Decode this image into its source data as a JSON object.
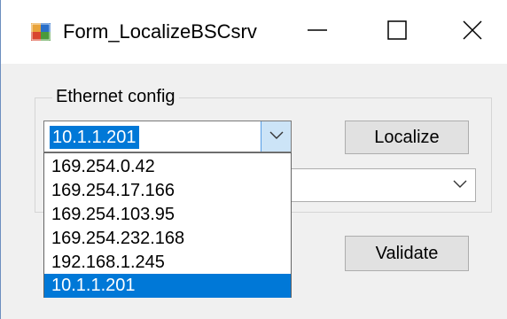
{
  "window": {
    "title": "Form_LocalizeBSCsrv",
    "icon": "form-app-icon",
    "controls": [
      "minimize-icon",
      "maximize-icon",
      "close-icon"
    ]
  },
  "group": {
    "label": "Ethernet config"
  },
  "ip_combo": {
    "value": "10.1.1.201",
    "options": [
      "169.254.0.42",
      "169.254.17.166",
      "169.254.103.95",
      "169.254.232.168",
      "192.168.1.245",
      "10.1.1.201"
    ],
    "selected_index": 5
  },
  "second_combo": {
    "value": ""
  },
  "buttons": {
    "localize": "Localize",
    "validate": "Validate"
  },
  "colors": {
    "selection": "#0078d7",
    "window_bg": "#f0f0f0",
    "button_bg": "#e1e1e1"
  }
}
